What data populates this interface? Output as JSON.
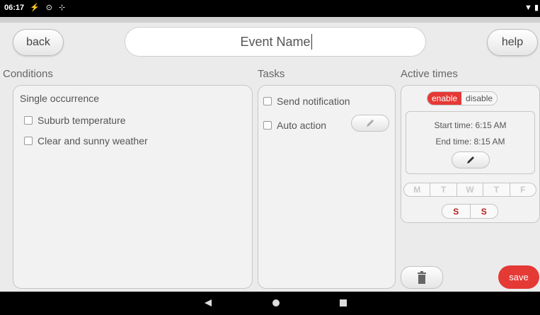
{
  "status_bar": {
    "time": "06:17",
    "left_icons": "⚡ ⊙ ⊹",
    "right_icons": "▼ ▮"
  },
  "header": {
    "back_label": "back",
    "help_label": "help",
    "event_name_value": "Event Name",
    "event_name_placeholder": "Event Name"
  },
  "sections": {
    "conditions": "Conditions",
    "tasks": "Tasks",
    "active_times": "Active times"
  },
  "conditions": {
    "occurrence": "Single occurrence",
    "items": [
      {
        "label": "Suburb temperature",
        "checked": false
      },
      {
        "label": "Clear and sunny weather",
        "checked": false
      }
    ]
  },
  "tasks": {
    "items": [
      {
        "label": "Send notification",
        "checked": false
      },
      {
        "label": "Auto action",
        "checked": false
      }
    ]
  },
  "active_times": {
    "toggle": {
      "enable": "enable",
      "disable": "disable",
      "selected": "enable"
    },
    "start_time": "Start time: 6:15 AM",
    "end_time": "End time: 8:15 AM",
    "weekdays": [
      "M",
      "T",
      "W",
      "T",
      "F"
    ],
    "weekend": [
      "S",
      "S"
    ]
  },
  "footer": {
    "save_label": "save"
  },
  "colors": {
    "accent": "#e53935",
    "weekend_active": "#b71c1c",
    "weekday_inactive": "#c8c8c8"
  },
  "icons": {
    "edit": "pencil-icon",
    "delete": "trash-icon",
    "nav_back": "triangle-back-icon",
    "nav_home": "circle-home-icon",
    "nav_recents": "square-recents-icon"
  }
}
